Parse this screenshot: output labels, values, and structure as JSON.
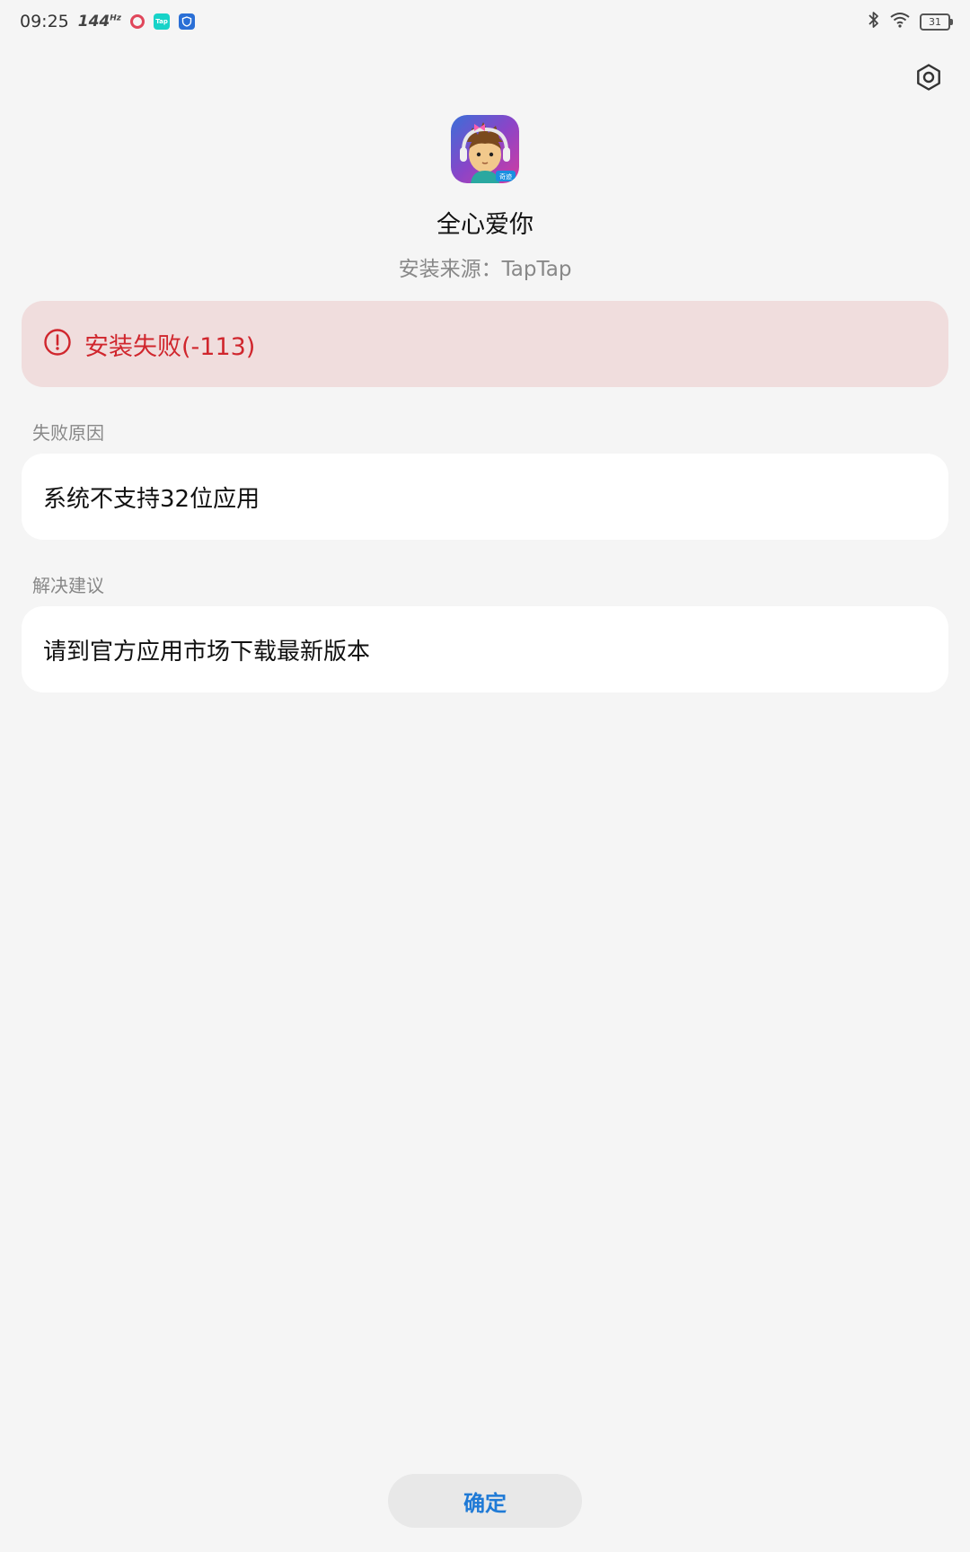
{
  "status_bar": {
    "time": "09:25",
    "refresh_rate": "144",
    "refresh_unit": "Hz",
    "taptap_badge": "Tap",
    "battery": "31"
  },
  "app": {
    "name": "全心爱你",
    "source": "安装来源：TapTap",
    "icon_badge": "奇迹"
  },
  "error": {
    "message": "安装失败(-113)"
  },
  "reason": {
    "label": "失败原因",
    "text": "系统不支持32位应用"
  },
  "suggestion": {
    "label": "解决建议",
    "text": "请到官方应用市场下载最新版本"
  },
  "actions": {
    "confirm_label": "确定"
  },
  "colors": {
    "error_red": "#d0262d",
    "error_bg": "#f0dddd",
    "accent_blue": "#1f7ad6",
    "page_bg": "#f5f5f5"
  },
  "icons": {
    "settings": "gear-icon",
    "error": "alert-circle-icon",
    "bluetooth": "bluetooth-icon",
    "wifi": "wifi-icon"
  }
}
